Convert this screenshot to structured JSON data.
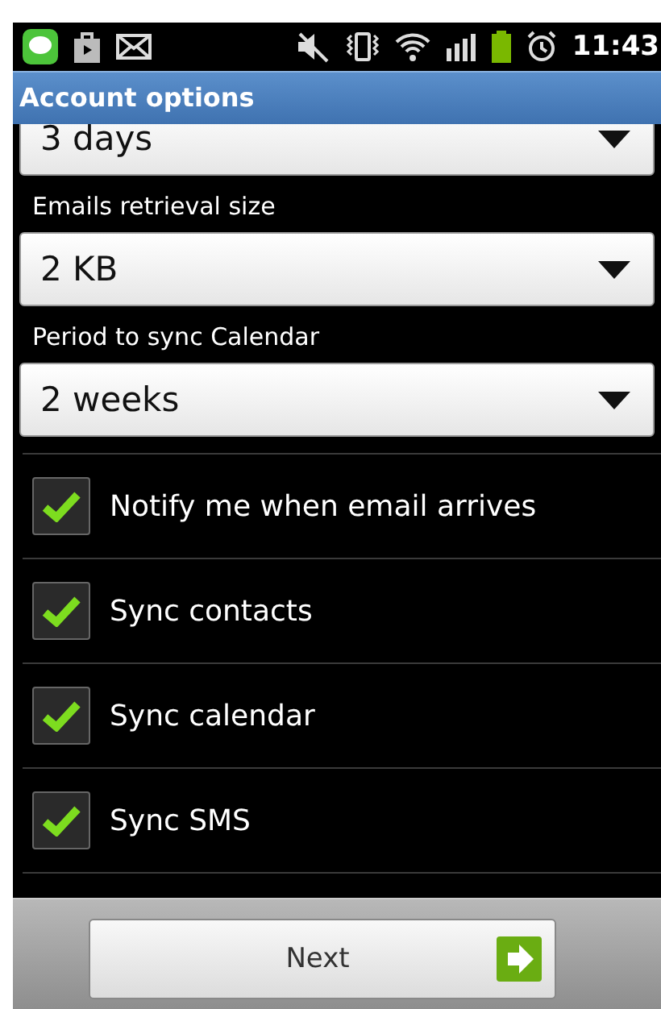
{
  "status_bar": {
    "time": "11:43"
  },
  "title": "Account options",
  "partial_spinner": {
    "value": "3 days"
  },
  "spinners": [
    {
      "label": "Emails retrieval size",
      "value": "2 KB"
    },
    {
      "label": "Period to sync Calendar",
      "value": "2 weeks"
    }
  ],
  "checkboxes": [
    {
      "label": "Notify me when email arrives",
      "checked": true
    },
    {
      "label": "Sync contacts",
      "checked": true
    },
    {
      "label": "Sync calendar",
      "checked": true
    },
    {
      "label": "Sync SMS",
      "checked": true
    }
  ],
  "next_button": {
    "label": "Next"
  }
}
